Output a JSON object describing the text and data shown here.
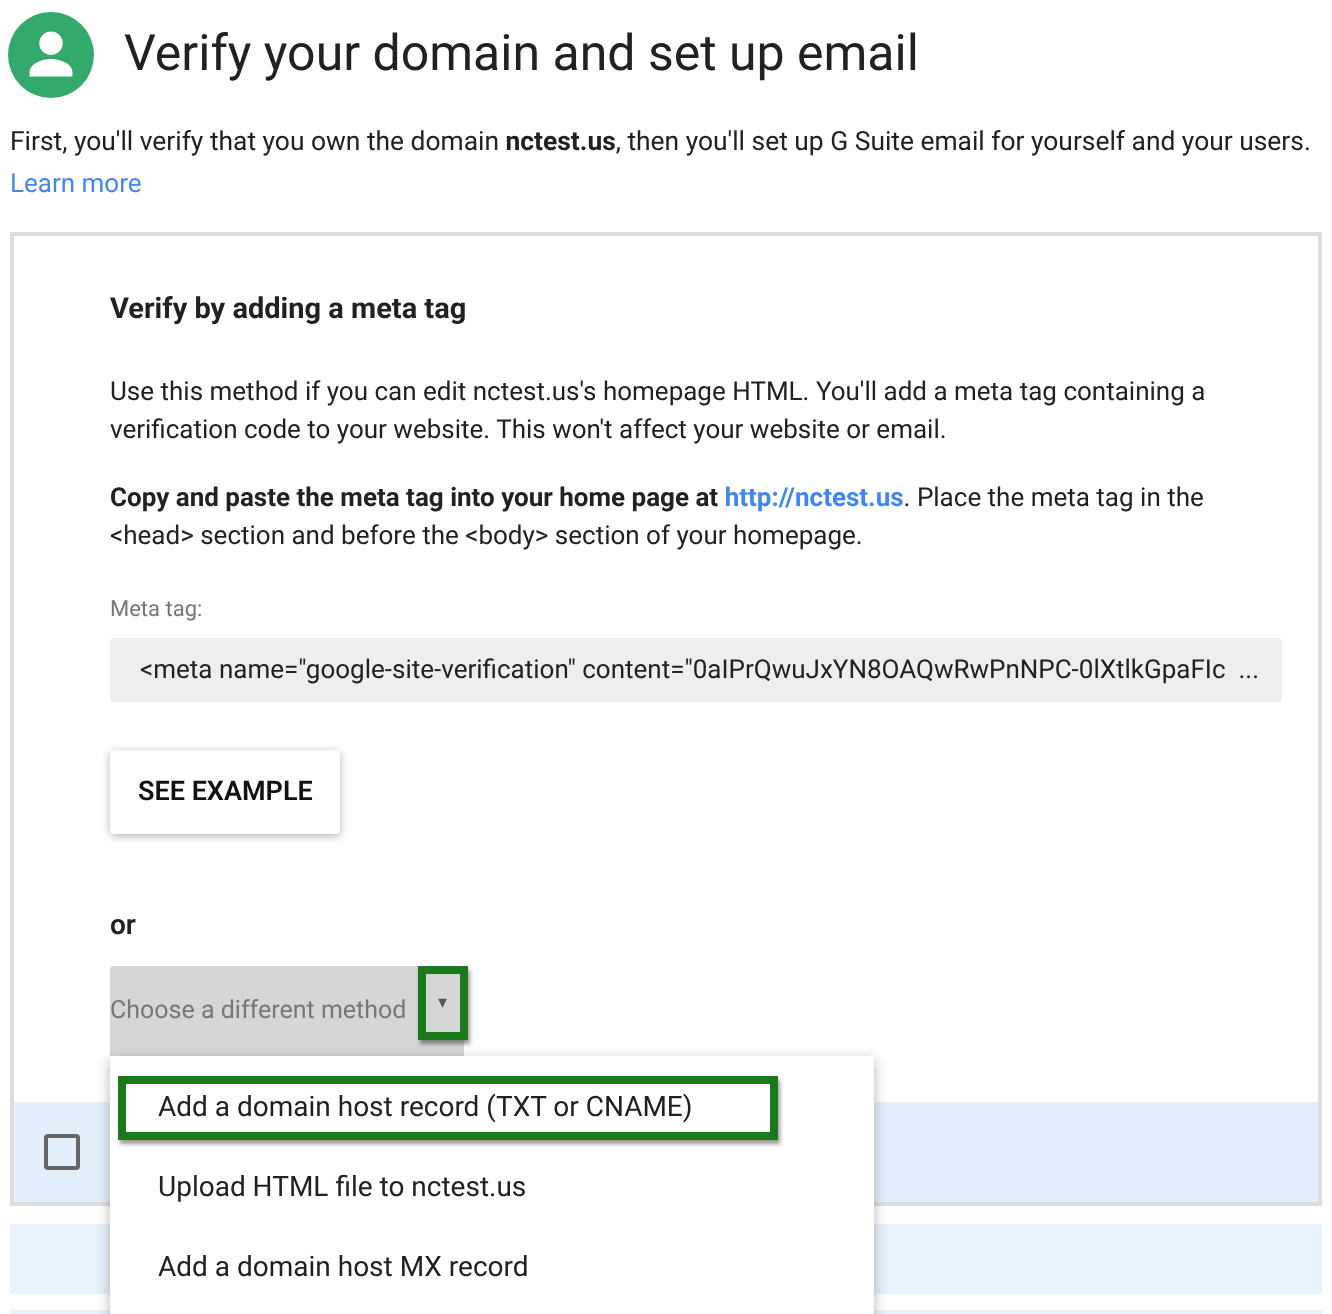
{
  "header": {
    "title": "Verify your domain and set up email"
  },
  "intro": {
    "text": "First, you'll verify that you own the domain **nctest.us**, then you'll set up G Suite email for yourself and your users.",
    "link": "Learn more"
  },
  "card": {
    "heading": "Verify by adding a meta tag",
    "description": "Use this method if you can edit nctest.us's homepage HTML. You'll add a meta tag containing a verification code to your website. This won't affect your website or email.",
    "instruction_bold": "Copy and paste the meta tag into your home page at",
    "instruction_link": "http://nctest.us",
    "instruction_rest": ". Place the meta tag in the <head> section and before the <body> section of your homepage.",
    "meta_label": "Meta tag:",
    "meta_value": "<meta name=\"google-site-verification\" content=\"0aIPrQwuJxYN8OAQwRwPnNPC-0lXtlkGpaFIc  ...",
    "example_button": "SEE EXAMPLE",
    "or": "or",
    "dropdown": {
      "placeholder": "Choose a different method",
      "arrow": "▾",
      "expanded": true,
      "highlighted": true
    },
    "checkbox_row": {
      "checked": false
    }
  },
  "menu": [
    {
      "label": "Add a domain host record (TXT or CNAME)",
      "highlighted": true
    },
    {
      "label": "Upload HTML file to nctest.us",
      "highlighted": false
    },
    {
      "label": "Add a domain host MX record",
      "highlighted": false
    }
  ]
}
